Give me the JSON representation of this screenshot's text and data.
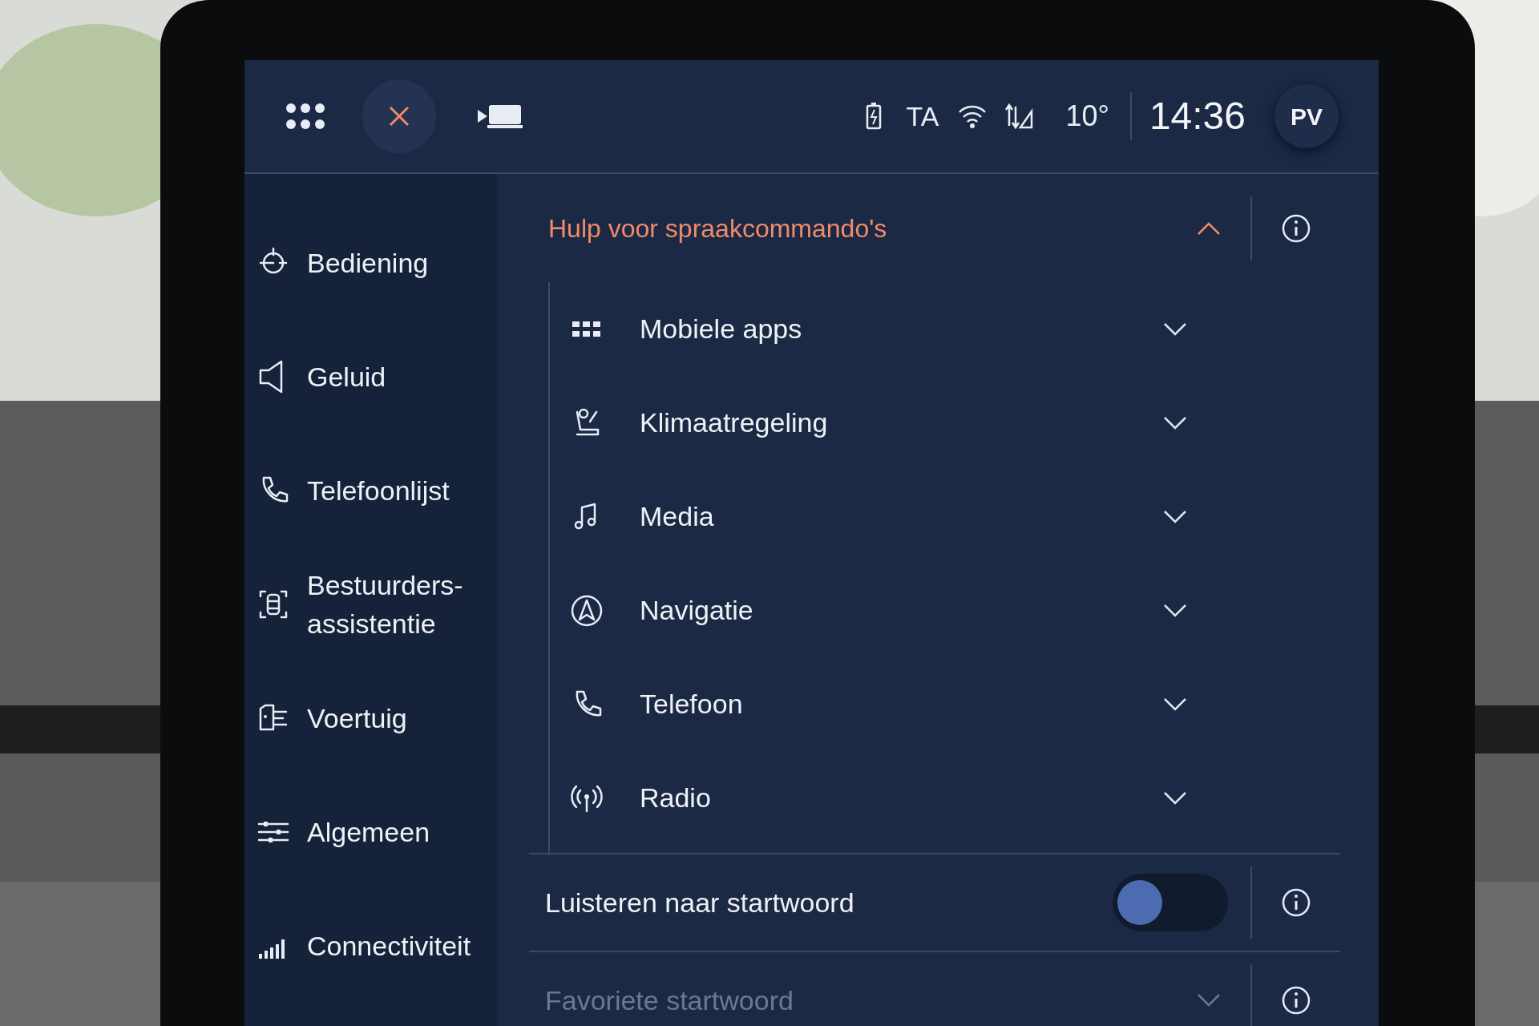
{
  "top_bar": {
    "status": [
      "TA",
      "10°"
    ],
    "time": "14:36",
    "profile": "PV"
  },
  "sidebar": {
    "items": [
      {
        "label": "Bediening"
      },
      {
        "label": "Geluid"
      },
      {
        "label": "Telefoonlijst"
      },
      {
        "label": "Bestuurders-\nassistentie"
      },
      {
        "label": "Voertuig"
      },
      {
        "label": "Algemeen"
      },
      {
        "label": "Connectiviteit"
      }
    ]
  },
  "section": {
    "title": "Hulp voor spraakcommando's",
    "expanded": true,
    "items": [
      {
        "label": "Mobiele apps",
        "expanded": false
      },
      {
        "label": "Klimaatregeling",
        "expanded": false
      },
      {
        "label": "Media",
        "expanded": false
      },
      {
        "label": "Navigatie",
        "expanded": false
      },
      {
        "label": "Telefoon",
        "expanded": false
      },
      {
        "label": "Radio",
        "expanded": false
      }
    ]
  },
  "settings": [
    {
      "kind": "toggle",
      "label": "Luisteren naar startwoord",
      "on": false,
      "disabled": false
    },
    {
      "kind": "dropdown",
      "label": "Favoriete startwoord",
      "disabled": true
    }
  ]
}
